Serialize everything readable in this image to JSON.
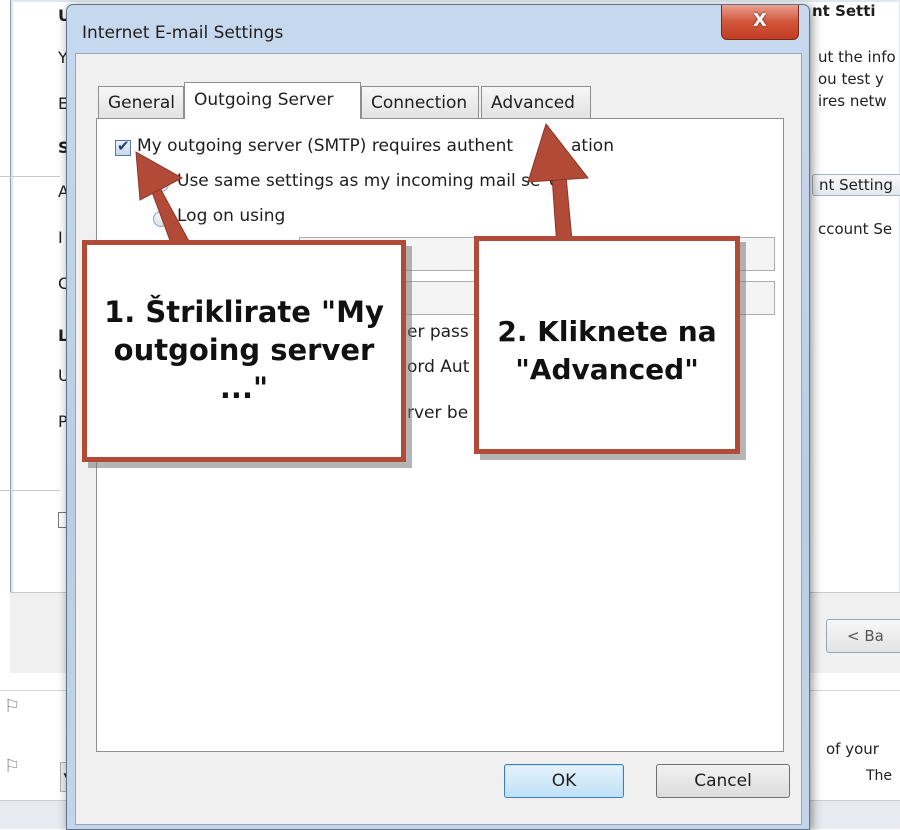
{
  "background_window": {
    "left_letters": [
      "U",
      "Y",
      "E",
      "S",
      "A",
      "I",
      "C",
      "L",
      "U",
      "P"
    ],
    "right_heading": "nt Setti",
    "right_lines": [
      "ut the info",
      "ou test y",
      "ires netw"
    ],
    "right_button": "nt Setting",
    "right_text2": "ccount Se",
    "back_button": "< Ba",
    "bottom_text1": "of your",
    "bottom_text2": "The"
  },
  "dialog": {
    "title": "Internet E-mail Settings",
    "close_label": "X",
    "tabs": [
      {
        "label": "General",
        "active": false
      },
      {
        "label": "Outgoing Server",
        "active": true
      },
      {
        "label": "Connection",
        "active": false
      },
      {
        "label": "Advanced",
        "active": false
      }
    ],
    "outgoing": {
      "requires_auth_label": "My outgoing server (SMTP) requires authentication",
      "requires_auth_visible": "My outgoing server (SMTP) requires authent",
      "requires_auth_tail": "ation",
      "requires_auth_checked": true,
      "same_settings_label": "Use same settings as my incoming mail server",
      "same_settings_visible": "Use same settings as my incoming mail se",
      "same_settings_tail": "er",
      "log_on_label": "Log on using",
      "partial_text_1": "er pass",
      "partial_text_2": "ord Aut",
      "partial_text_3": "rver be"
    },
    "ok_label": "OK",
    "cancel_label": "Cancel"
  },
  "annotations": {
    "callout_1": "1. Štriklirate \"My outgoing server ...\"",
    "callout_2": "2. Kliknete na \"Advanced\"",
    "accent_color": "#b14b38"
  }
}
